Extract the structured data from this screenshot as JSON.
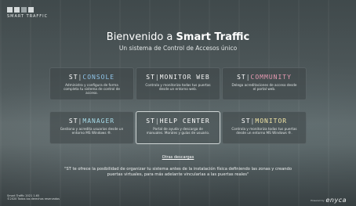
{
  "logo": {
    "text": "SMART TRAFFIC"
  },
  "hero": {
    "title_prefix": "Bienvenido a ",
    "title_brand": "Smart Traffic",
    "subtitle": "Un sistema de Control de Accesos único"
  },
  "modules": [
    {
      "prefix": "ST",
      "name": "CONSOLE",
      "accent": "#8fc3e8",
      "desc": "Administra y configura de forma completa tu sistema de control de acceso."
    },
    {
      "prefix": "ST",
      "name": "MONITOR WEB",
      "accent": "#f2f2f2",
      "desc": "Controla y monitoriza todas tus puertas desde un entorno web."
    },
    {
      "prefix": "ST",
      "name": "COMMUNITY",
      "accent": "#e79ab2",
      "desc": "Delega acreditaciones de acceso desde el portal web."
    },
    {
      "prefix": "ST",
      "name": "MANAGER",
      "accent": "#a6dbe8",
      "desc": "Gestiona y acredita usuarios desde un entorno MS Windows ®."
    },
    {
      "prefix": "ST",
      "name": "HELP CENTER",
      "accent": "#ffffff",
      "desc": "Portal de ayuda y descarga de manuales. Morales y guías de usuario."
    },
    {
      "prefix": "ST",
      "name": "MONITOR",
      "accent": "#f2e6a6",
      "desc": "Controla y monitoriza todas tus puertas desde un entorno MS Windows ®."
    }
  ],
  "other_downloads": "Otras descargas",
  "quote": "\"ST te ofrece la posibilidad de organizar tu sistema antes de la instalación física definiendo las zonas y creando puertas virtuales, para más adelante vincularlas a las puertas reales\"",
  "footer": {
    "line1": "Smart Traffic 2021 1.65",
    "line2": "©2020 Todos los derechos reservados"
  },
  "brand": {
    "by": "Powered by",
    "name": "enyca"
  },
  "colors": {
    "background": "#5c6668",
    "card_bg": "#3c4446"
  }
}
